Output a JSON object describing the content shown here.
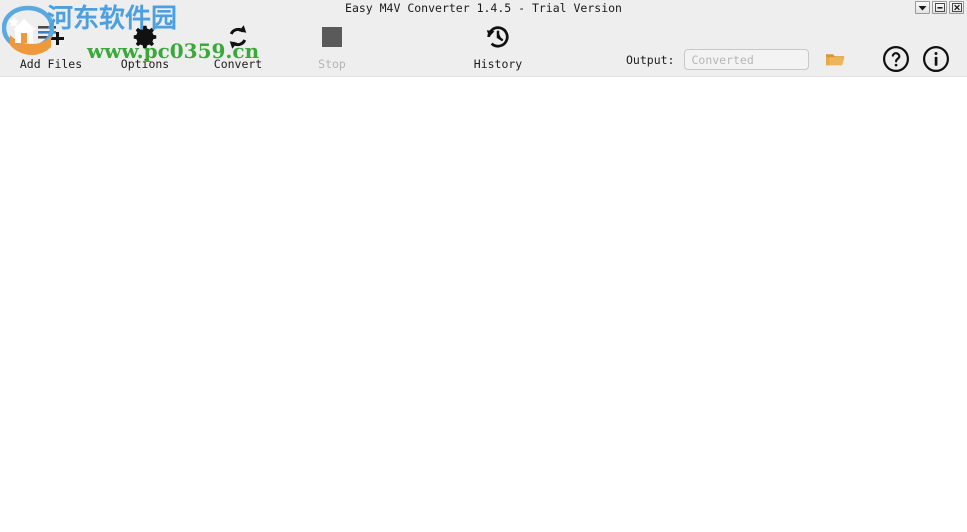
{
  "window": {
    "title": "Easy M4V Converter 1.4.5 - Trial Version",
    "controls": [
      {
        "name": "dropdown-button",
        "icon": "chevron-down-icon"
      },
      {
        "name": "minimize-button",
        "icon": "minimize-icon"
      },
      {
        "name": "close-button",
        "icon": "close-icon"
      }
    ]
  },
  "toolbar": {
    "buttons": [
      {
        "id": "add-files",
        "label": "Add Files",
        "icon": "add-files-icon",
        "disabled": false
      },
      {
        "id": "options",
        "label": "Options",
        "icon": "gear-icon",
        "disabled": false
      },
      {
        "id": "convert",
        "label": "Convert",
        "icon": "refresh-icon",
        "disabled": false
      },
      {
        "id": "stop",
        "label": "Stop",
        "icon": "stop-square-icon",
        "disabled": true
      },
      {
        "id": "history",
        "label": "History",
        "icon": "clock-history-icon",
        "disabled": false
      }
    ],
    "output": {
      "label": "Output:",
      "value": "",
      "placeholder": "Converted",
      "browse_icon": "folder-open-icon"
    },
    "help_icon": "question-circle-icon",
    "info_icon": "info-circle-icon"
  },
  "watermark": {
    "site_name": "河东软件园",
    "url": "www.pc0359.cn",
    "logo_icon": "site-logo-icon"
  },
  "colors": {
    "toolbar_bg": "#eeeeee",
    "content_bg": "#ffffff",
    "label_text": "#1c1c1c",
    "disabled_text": "#b4b4b4",
    "placeholder_text": "#b6b6b6",
    "stop_square": "#5a5a5a",
    "folder_icon": "#e0a43c",
    "watermark_blue": "#4da0e0",
    "watermark_green": "#3aa83a"
  }
}
